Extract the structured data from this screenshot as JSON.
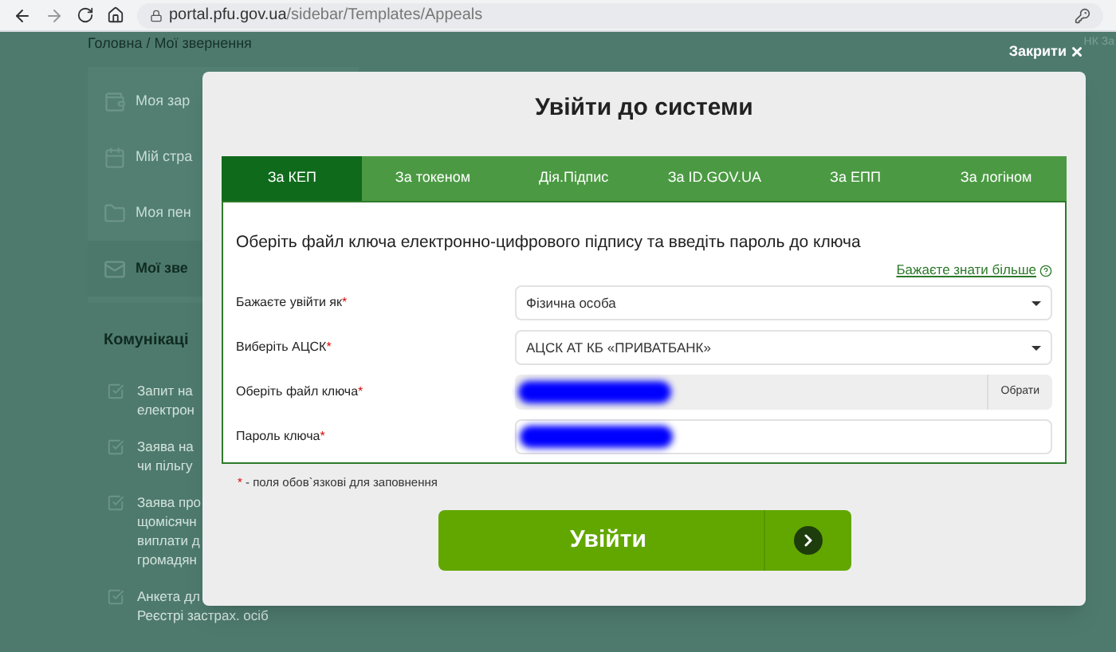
{
  "browser": {
    "url_host": "portal.pfu.gov.ua",
    "url_path": "/sidebar/Templates/Appeals"
  },
  "page": {
    "breadcrumb": "Головна / Мої звернення",
    "top_right": "НК За",
    "menu": [
      {
        "label": "Моя зар",
        "selected": false
      },
      {
        "label": "Мій стра",
        "selected": false
      },
      {
        "label": "Моя пен",
        "selected": false
      },
      {
        "label": "Мої зве",
        "selected": true
      }
    ],
    "section_title": "Комунікаці",
    "links": [
      [
        "Запит на",
        "електрон"
      ],
      [
        "Заява на",
        "чи пільгу"
      ],
      [
        "Заява про",
        "щомісячн",
        "виплати д",
        "громадян"
      ],
      [
        "Анкета дл",
        "Реєстрі застрах. осіб"
      ]
    ]
  },
  "dialog": {
    "close": "Закрити",
    "title": "Увійти до системи",
    "tabs": [
      {
        "label": "За КЕП",
        "selected": true
      },
      {
        "label": "За токеном",
        "selected": false
      },
      {
        "label": "Дія.Підпис",
        "selected": false
      },
      {
        "label": "За ID.GOV.UA",
        "selected": false
      },
      {
        "label": "За ЕПП",
        "selected": false
      },
      {
        "label": "За логіном",
        "selected": false
      }
    ],
    "instruction": "Оберіть файл ключа електронно-цифрового підпису та введіть пароль до ключа",
    "help_link": "Бажаєте знати більше",
    "fields": [
      {
        "kind": "select",
        "label": "Бажаєте увійти як",
        "value": "Фізична особа"
      },
      {
        "kind": "select",
        "label": "Виберіть АЦСК",
        "value": "АЦСК АТ КБ «ПРИВАТБАНК»"
      },
      {
        "kind": "file",
        "label": "Оберіть файл ключа",
        "button": "Обрати"
      },
      {
        "kind": "password",
        "label": "Пароль ключа"
      }
    ],
    "required_mark": "*",
    "required_note": " - поля обов`язкові для заповнення",
    "submit": "Увійти"
  }
}
